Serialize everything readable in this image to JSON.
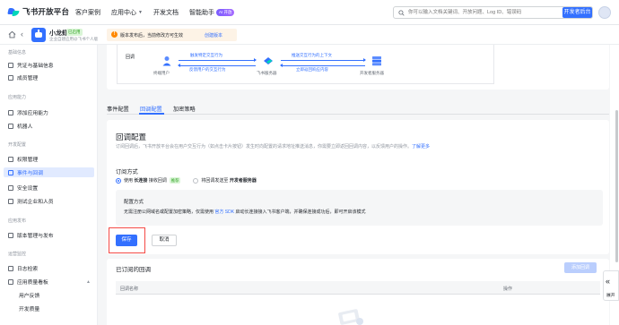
{
  "brand": {
    "name": "飞书开放平台"
  },
  "nav": {
    "items": [
      {
        "label": "客户案例"
      },
      {
        "label": "应用中心"
      },
      {
        "label": "开发文档"
      },
      {
        "label": "智能助手"
      }
    ],
    "ai_badge": "AI 开放"
  },
  "search": {
    "placeholder": "你可以输入文档关键词、开放问题、Log ID、错误码"
  },
  "header": {
    "dev_console": "开发者后台"
  },
  "app": {
    "name": "小龙虾",
    "status": "已启用",
    "subtitle": "企业自建应用@飞书个人版"
  },
  "notice": {
    "text": "版本发布后，当前修改方可生效",
    "link": "创建版本"
  },
  "sidebar": {
    "groups": [
      {
        "label": "基础信息"
      },
      {
        "label": "应用能力"
      },
      {
        "label": "开发配置"
      },
      {
        "label": "应用发布"
      },
      {
        "label": "运营监控"
      }
    ],
    "items": [
      {
        "label": "凭证与基础信息"
      },
      {
        "label": "成员管理"
      },
      {
        "label": "添加应用能力"
      },
      {
        "label": "机器人"
      },
      {
        "label": "权限管理"
      },
      {
        "label": "事件与回调"
      },
      {
        "label": "安全设置"
      },
      {
        "label": "测试企业和人员"
      },
      {
        "label": "版本管理与发布"
      },
      {
        "label": "日志检索"
      },
      {
        "label": "应用质量看板"
      },
      {
        "label": "用户反馈"
      },
      {
        "label": "开发质量"
      }
    ]
  },
  "flow": {
    "tag": "回调",
    "end_user": "终端用户",
    "feishu_server": "飞书服务器",
    "dev_server": "开发者服务器",
    "arrow_1": "触发特定交互行为",
    "arrow_2": "反馈用户的交互行为",
    "arrow_3": "推送交互行为的上下文",
    "arrow_4": "立即返回响应内容"
  },
  "tabs": [
    {
      "label": "事件配置"
    },
    {
      "label": "回调配置"
    },
    {
      "label": "加密策略"
    }
  ],
  "config": {
    "title": "回调配置",
    "desc": "订阅回调后，飞书开放平台会在用户交互行为（如点击卡片按钮）发生时向配置的请求地址推送消息，你需要立即返回回调内容，以反馈用户的操作。",
    "desc_link": "了解更多",
    "subscribe_title": "订阅方式",
    "option_1_prefix": "使用",
    "option_1_bold": "长连接",
    "option_1_suffix": "接收回调",
    "recommended": "推荐",
    "option_2_prefix": "将回调发送至",
    "option_2_bold": "开发者服务器",
    "method_title": "配置方式",
    "method_desc_1": "无需注册公网域名或配置加密策略，仅需使用",
    "method_desc_link": "官方 SDK",
    "method_desc_2": "启动长连接接入飞书客户端，并确保连接成功后，即可开启该模式",
    "save": "保存",
    "cancel": "取消"
  },
  "subscribed": {
    "title": "已订阅的回调",
    "add_button": "添加回调",
    "col_name": "回调名称",
    "col_action": "操作"
  },
  "help_dock": {
    "label": "展开"
  },
  "colors": {
    "primary": "#3370ff",
    "highlight": "#f54a45",
    "success": "#2ea121"
  }
}
